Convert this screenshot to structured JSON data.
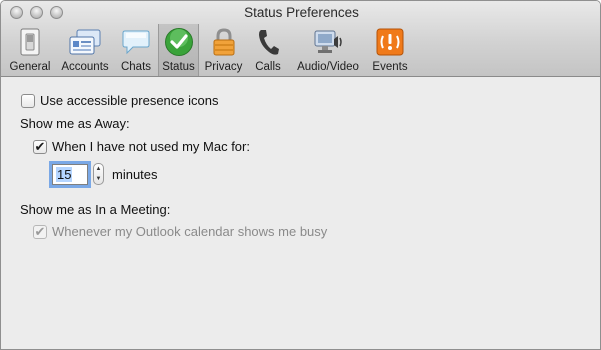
{
  "window": {
    "title": "Status Preferences"
  },
  "toolbar": {
    "items": [
      {
        "label": "General",
        "icon": "switch-icon"
      },
      {
        "label": "Accounts",
        "icon": "accounts-icon"
      },
      {
        "label": "Chats",
        "icon": "chat-bubble-icon"
      },
      {
        "label": "Status",
        "icon": "status-checkmark-icon",
        "selected": true
      },
      {
        "label": "Privacy",
        "icon": "padlock-icon"
      },
      {
        "label": "Calls",
        "icon": "phone-handset-icon"
      },
      {
        "label": "Audio/Video",
        "icon": "webcam-speaker-icon"
      },
      {
        "label": "Events",
        "icon": "alert-events-icon"
      }
    ]
  },
  "content": {
    "accessible_icons": {
      "label": "Use accessible presence icons",
      "checked": false
    },
    "away_heading": "Show me as Away:",
    "away_idle": {
      "label": "When I have not used my Mac for:",
      "checked": true
    },
    "minutes": {
      "value": "15",
      "unit": "minutes"
    },
    "meeting_heading": "Show me as In a Meeting:",
    "meeting_calendar": {
      "label": "Whenever my Outlook calendar shows me busy",
      "checked": true,
      "disabled": true
    }
  },
  "colors": {
    "status_green": "#3aa33a",
    "events_orange": "#f07a1a",
    "focus_ring": "#7aa8e6"
  }
}
